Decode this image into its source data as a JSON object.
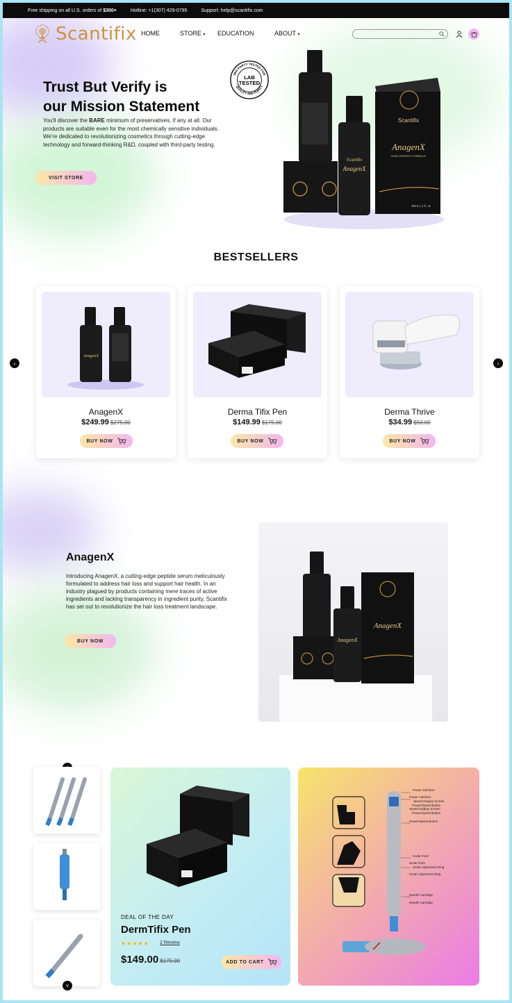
{
  "topbar": {
    "shipping_prefix": "Free shipping on all U.S. orders of",
    "shipping_amount": "$300+",
    "hotline": "Hotline: +1(307) 429-0795",
    "support": "Support: help@scantifix.com"
  },
  "header": {
    "brand": "Scantifix",
    "nav": [
      "HOME",
      "STORE",
      "EDUCATION",
      "ABOUT"
    ]
  },
  "hero": {
    "title_line1": "Trust But Verify is",
    "title_line2": "our Mission Statement",
    "text_before": "You'll discover the ",
    "text_bold": "BARE",
    "text_after": " minimum of preservatives, if any at all. Our products are suitable even for the most chemically sensitive individuals. We're dedicated to revolutionizing cosmetics through cutting-edge technology and forward-thinking R&D, coupled with third-party testing.",
    "button": "VISIT STORE",
    "badge_main_1": "LAB",
    "badge_main_2": "TESTED",
    "badge_ring_top": "3RD PARTY TESTED FOR",
    "badge_ring_bottom": "QUALITY AND PURITY",
    "product_brand": "Scantifix",
    "product_name": "AnagenX",
    "product_sub": "HAIR GROWTH FORMULA",
    "product_volume": "30mL | 1 fl. oz"
  },
  "bestsellers": {
    "title": "BESTSELLERS",
    "products": [
      {
        "name": "AnagenX",
        "price": "$249.99",
        "old_price": "$275.00",
        "button": "BUY NOW"
      },
      {
        "name": "Derma Tifix Pen",
        "price": "$149.99",
        "old_price": "$175.00",
        "button": "BUY NOW"
      },
      {
        "name": "Derma Thrive",
        "price": "$34.99",
        "old_price": "$50.00",
        "button": "BUY NOW"
      }
    ]
  },
  "feature": {
    "title": "AnagenX",
    "text": "Introducing AnagenX, a cutting-edge peptide serum meticulously formulated to address hair loss and support hair health. In an industry plagued by products containing mere traces of active ingredients and lacking transparency in ingredient purity, Scantifix has set out to revolutionize the hair loss treatment landscape.",
    "button": "BUY NOW"
  },
  "deal": {
    "label": "DEAL OF THE DAY",
    "name": "DermTifix Pen",
    "stars": "★★★★★",
    "rating": 5,
    "reviews": "2 Review",
    "price": "$149.00",
    "old_price": "$175.00",
    "button": "ADD TO CART"
  },
  "diagram": {
    "labels": [
      "Power Interface",
      "Power Interface",
      "Speed Display Screen",
      "Power/Speed Button",
      "Speed Display Screen",
      "Power/Speed Button",
      "Power/Speed Button",
      "Scale Point",
      "Scale Point",
      "Scale Adjustment Ring",
      "Scale Adjustment Ring",
      "Needle Cartridge",
      "Needle Cartridge"
    ]
  },
  "colors": {
    "brand_gold": "#c9963e",
    "button_gradient_start": "#fbe7a8",
    "button_gradient_end": "#f3b6ee",
    "topbar_bg": "#0c0c0c"
  }
}
